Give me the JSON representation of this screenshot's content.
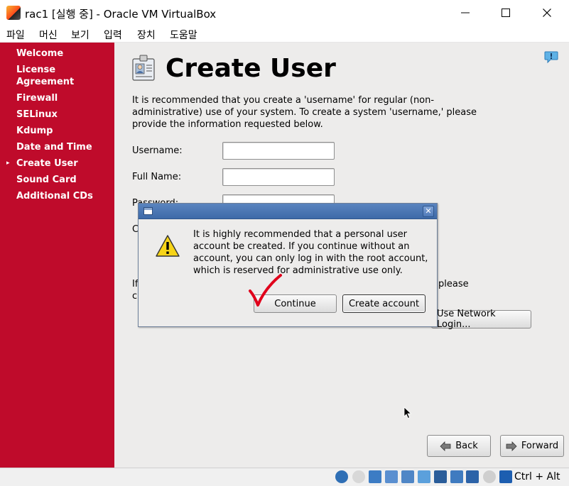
{
  "window": {
    "title": "rac1 [실행 중] - Oracle VM VirtualBox"
  },
  "menubar": {
    "items": [
      "파일",
      "머신",
      "보기",
      "입력",
      "장치",
      "도움말"
    ]
  },
  "sidebar": {
    "items": [
      {
        "label": "Welcome"
      },
      {
        "label": "License\nAgreement"
      },
      {
        "label": "Firewall"
      },
      {
        "label": "SELinux"
      },
      {
        "label": "Kdump"
      },
      {
        "label": "Date and Time"
      },
      {
        "label": "Create User",
        "current": true
      },
      {
        "label": "Sound Card"
      },
      {
        "label": "Additional CDs"
      }
    ],
    "bullet": "▸"
  },
  "page": {
    "title": "Create User",
    "description": "It is recommended that you create a 'username' for regular (non-administrative) use of your system. To create a system 'username,' please provide the information requested below.",
    "fields": {
      "username_label": "Username:",
      "fullname_label": "Full Name:",
      "password_label": "Password:",
      "confirm_label_partial": "C",
      "username_value": "",
      "fullname_value": "",
      "password_value": ""
    },
    "partial_text_left_1": "If",
    "partial_text_left_2": "c",
    "partial_text_right": "please",
    "network_login_button": "Use Network Login...",
    "back_button": "Back",
    "forward_button": "Forward"
  },
  "dialog": {
    "message": "It is highly recommended that a personal user account be created.  If you continue without an account, you can only log in with the root account, which is reserved for administrative use only.",
    "continue_button": "Continue",
    "create_account_button": "Create account",
    "close_glyph": "✕"
  },
  "statusbar": {
    "host_key": "Ctrl + Alt"
  },
  "colors": {
    "sidebar": "#bf0b2b",
    "background": "#edeceb",
    "dialog_titlebar": "#4672b0",
    "annotation_check": "#e0001b"
  }
}
